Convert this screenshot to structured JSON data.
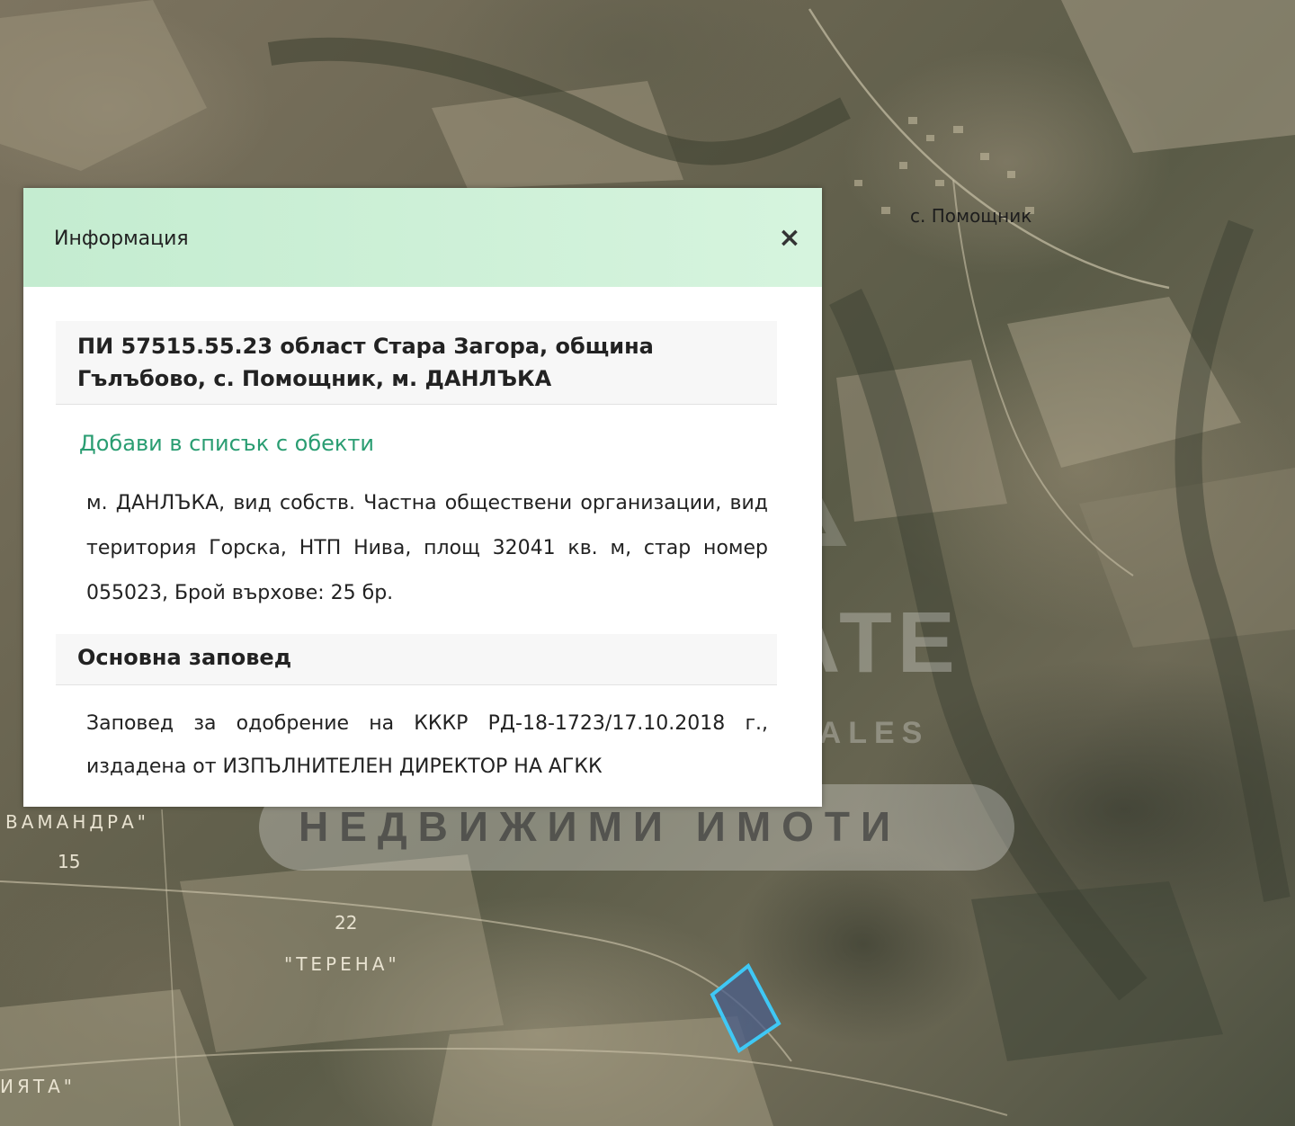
{
  "map": {
    "labels": {
      "village": "с. Помощник",
      "area_left": "ВАМАНДРА\"",
      "num_15": "15",
      "num_22": "22",
      "area_terena": "\"ТЕРЕНА\"",
      "area_bottom": "ИЯТА\""
    },
    "watermark": {
      "line1": "ATOL ESTATE",
      "line2": "SALES",
      "line3": "НЕДВИЖИМИ ИМОТИ"
    },
    "parcel_color": "#3fc8f5"
  },
  "popup": {
    "title": "Информация",
    "close_icon": "×",
    "parcel_title": "ПИ 57515.55.23 област Стара Загора, община Гълъбово, с. Помощник, м. ДАНЛЪКА",
    "add_link": "Добави в списък с обекти",
    "description": "м. ДАНЛЪКА, вид собств. Частна обществени организации, вид територия Горска, НТП Нива, площ 32041 кв. м, стар номер 055023, Брой върхове: 25 бр.",
    "order_title": "Основна заповед",
    "order_text": "Заповед за одобрение на КККР РД-18-1723/17.10.2018 г., издадена от ИЗПЪЛНИТЕЛЕН ДИРЕКТОР НА АГКК",
    "header_color": "#c4ecd0",
    "link_color": "#2a9d72"
  }
}
